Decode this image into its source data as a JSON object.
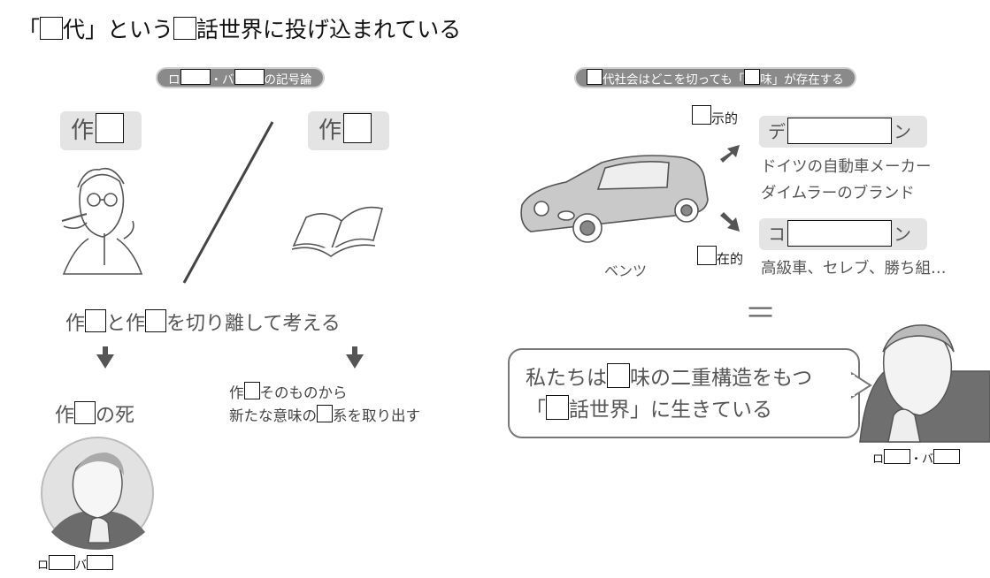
{
  "title": {
    "p1": "「",
    "p2": "代」という",
    "p3": "話世界に投げ込まれている"
  },
  "left_pill": {
    "p1": "ロ",
    "p2": "・バ",
    "p3": "の記号論"
  },
  "author_card": {
    "label": "作"
  },
  "work_card": {
    "label": "作"
  },
  "separate_line": {
    "p1": "作",
    "p2": "と作",
    "p3": "を切り離して考える"
  },
  "author_death": {
    "p1": "作",
    "p2": "の死"
  },
  "new_meaning": {
    "line1": "そのものから",
    "line1_prefix": "作",
    "line2_p1": "新たな意味の",
    "line2_p2": "系を取り出す"
  },
  "caption_left": {
    "p1": "ロ",
    "p2": "バ"
  },
  "right_pill": {
    "p1": "代社会はどこを切っても「",
    "p2": "味」が存在する"
  },
  "denote_label": "示的",
  "connote_label": "在的",
  "denote_term": {
    "p1": "デ",
    "p2": "ン"
  },
  "connote_term": {
    "p1": "コ",
    "p2": "ン"
  },
  "denote_desc": {
    "line1": "ドイツの自動車メーカー",
    "line2": "ダイムラーのブランド"
  },
  "connote_desc": "高級車、セレブ、勝ち組…",
  "car_label": "ベンツ",
  "equals_mark": "||",
  "speech": {
    "l1_p1": "私たちは",
    "l1_p2": "味の二重構造をもつ",
    "l2_p1": "「",
    "l2_p2": "話世界」に生きている"
  },
  "caption_right": {
    "p1": "ロ",
    "p2": "・バ"
  },
  "colors": {
    "pill_bg": "#8a8a8a",
    "card_bg": "#e4e4e4",
    "text": "#555555",
    "line": "#444444"
  }
}
